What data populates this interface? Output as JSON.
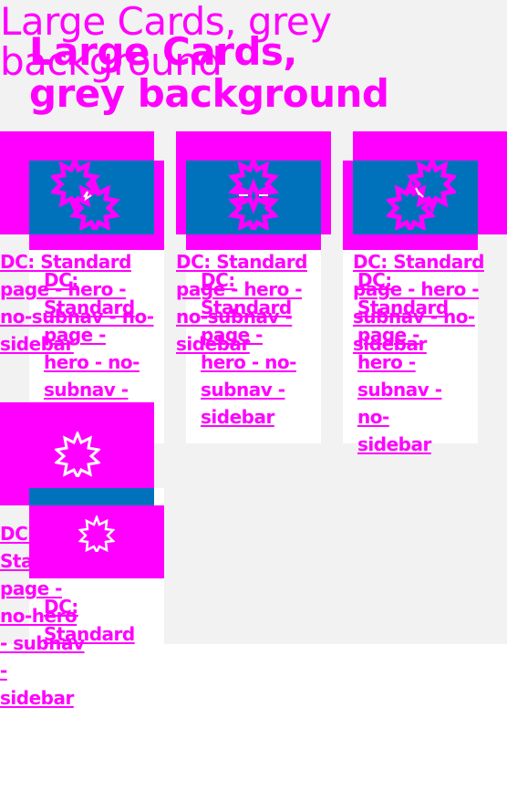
{
  "page": {
    "title": "Large Cards, grey background",
    "title_shadow": "Large Cards, grey background"
  },
  "cards": [
    {
      "link": "DC: Standard page - hero - no-subnav - no-sidebar",
      "link_shadow": "DC: Standard page - hero - no-subnav - sidebar"
    },
    {
      "link": "DC: Standard page - hero - no-subnav - sidebar",
      "link_shadow": "DC: Standard page - hero - no-subnav - sidebar"
    },
    {
      "link": "DC: Standard page - hero - subnav - no-sidebar",
      "link_shadow": "DC: Standard page - hero - subnav - no-sidebar"
    },
    {
      "link": "DC: Standard page - no-hero - subnav - sidebar",
      "link_shadow": "DC: Standard"
    }
  ],
  "icons": [
    "badge-icon",
    "badge-icon-pair"
  ],
  "colors": {
    "accent": "#ff00ff",
    "image_blue": "#0072bc",
    "grey_bg": "#f2f2f2",
    "card_bg": "#ffffff"
  }
}
